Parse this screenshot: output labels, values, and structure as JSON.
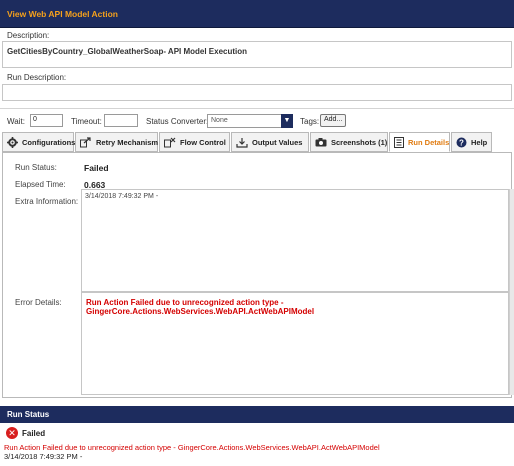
{
  "window": {
    "title": "View Web API Model Action"
  },
  "description": {
    "label": "Description:",
    "value": "GetCitiesByCountry_GlobalWeatherSoap- API Model Execution"
  },
  "run_description": {
    "label": "Run Description:",
    "value": ""
  },
  "options": {
    "wait_label": "Wait:",
    "wait_value": "0",
    "timeout_label": "Timeout:",
    "timeout_value": "",
    "status_converter_label": "Status Converter:",
    "status_converter_value": "None",
    "tags_label": "Tags:",
    "add_label": "Add..."
  },
  "tabs": [
    {
      "label": "Configurations",
      "icon": "gear-icon"
    },
    {
      "label": "Retry Mechanism",
      "icon": "retry-icon"
    },
    {
      "label": "Flow Control",
      "icon": "flow-control-icon"
    },
    {
      "label": "Output Values",
      "icon": "output-values-icon"
    },
    {
      "label": "Screenshots (1)",
      "icon": "camera-icon"
    },
    {
      "label": "Run Details",
      "icon": "run-details-icon",
      "active": true
    },
    {
      "label": "Help",
      "icon": "help-icon"
    }
  ],
  "run_details": {
    "run_status_label": "Run Status:",
    "run_status_value": "Failed",
    "elapsed_label": "Elapsed Time:",
    "elapsed_value": "0.663",
    "extra_label": "Extra Information:",
    "extra_value": "3/14/2018 7:49:32 PM -",
    "error_label": "Error Details:",
    "error_value": "Run Action Failed due to unrecognized action type - GingerCore.Actions.WebServices.WebAPI.ActWebAPIModel"
  },
  "run_status_panel": {
    "header": "Run Status",
    "status": "Failed",
    "message": "Run Action Failed due to unrecognized action type - GingerCore.Actions.WebServices.WebAPI.ActWebAPIModel",
    "timestamp": "3/14/2018 7:49:32 PM -"
  },
  "colors": {
    "title_bar": "#1d2c5e",
    "title_text": "#f5a11c",
    "active_tab": "#e07b10",
    "error": "#d40000"
  }
}
